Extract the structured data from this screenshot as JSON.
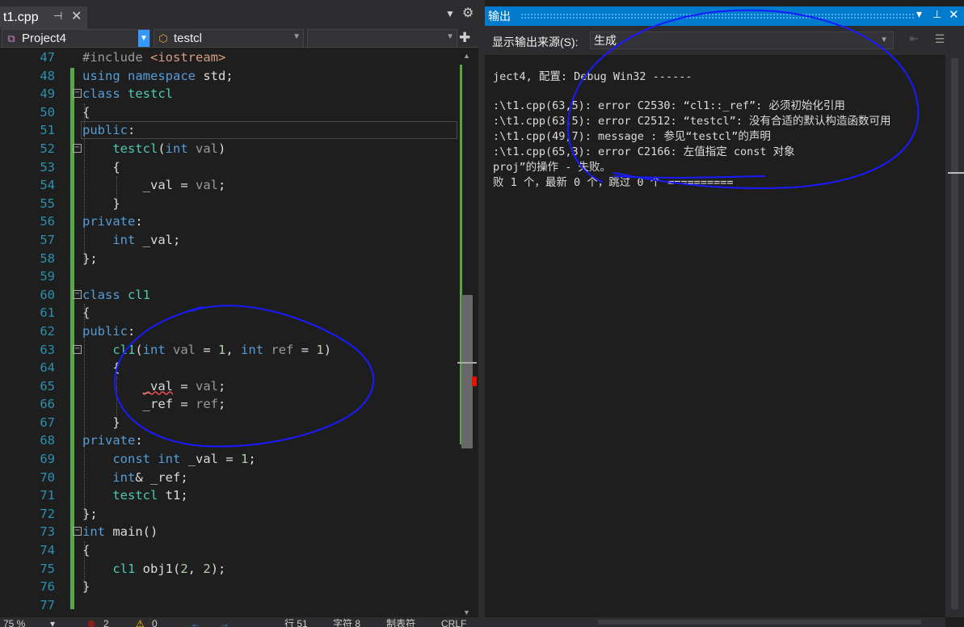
{
  "editor": {
    "tab_title": "t1.cpp",
    "tab_pin_icon": "pin-icon",
    "tab_close_icon": "close-icon",
    "nav": {
      "project": "Project4",
      "scope": "testcl",
      "member": ""
    },
    "line_numbers": [
      "47",
      "48",
      "49",
      "50",
      "51",
      "52",
      "53",
      "54",
      "55",
      "56",
      "57",
      "58",
      "59",
      "60",
      "61",
      "62",
      "63",
      "64",
      "65",
      "66",
      "67",
      "68",
      "69",
      "70",
      "71",
      "72",
      "73",
      "74",
      "75",
      "76",
      "77"
    ]
  },
  "statusbar": {
    "zoom": "75 %",
    "errors": "2",
    "warnings": "0",
    "line": "行 51",
    "char": "字符 8",
    "tabs": "制表符",
    "eol": "CRLF"
  },
  "output": {
    "title": "输出",
    "source_label": "显示输出来源(S):",
    "source_value": "生成",
    "lines": [
      "ject4, 配置: Debug Win32 ------",
      "",
      ":\\t1.cpp(63,5): error C2530: “cl1::_ref”: 必须初始化引用",
      ":\\t1.cpp(63,5): error C2512: “testcl”: 没有合适的默认构造函数可用",
      ":\\t1.cpp(49,7): message : 参见“testcl”的声明",
      ":\\t1.cpp(65,3): error C2166: 左值指定 const 对象",
      "proj”的操作 - 失败。",
      "败 1 个，最新 0 个，跳过 0 个 =========="
    ]
  },
  "colors": {
    "accent": "#007acc",
    "keyword": "#569cd6",
    "type": "#4ec9b0",
    "number": "#b5cea8",
    "line_number": "#2b91af",
    "annotation_ink": "#1a1aff"
  }
}
